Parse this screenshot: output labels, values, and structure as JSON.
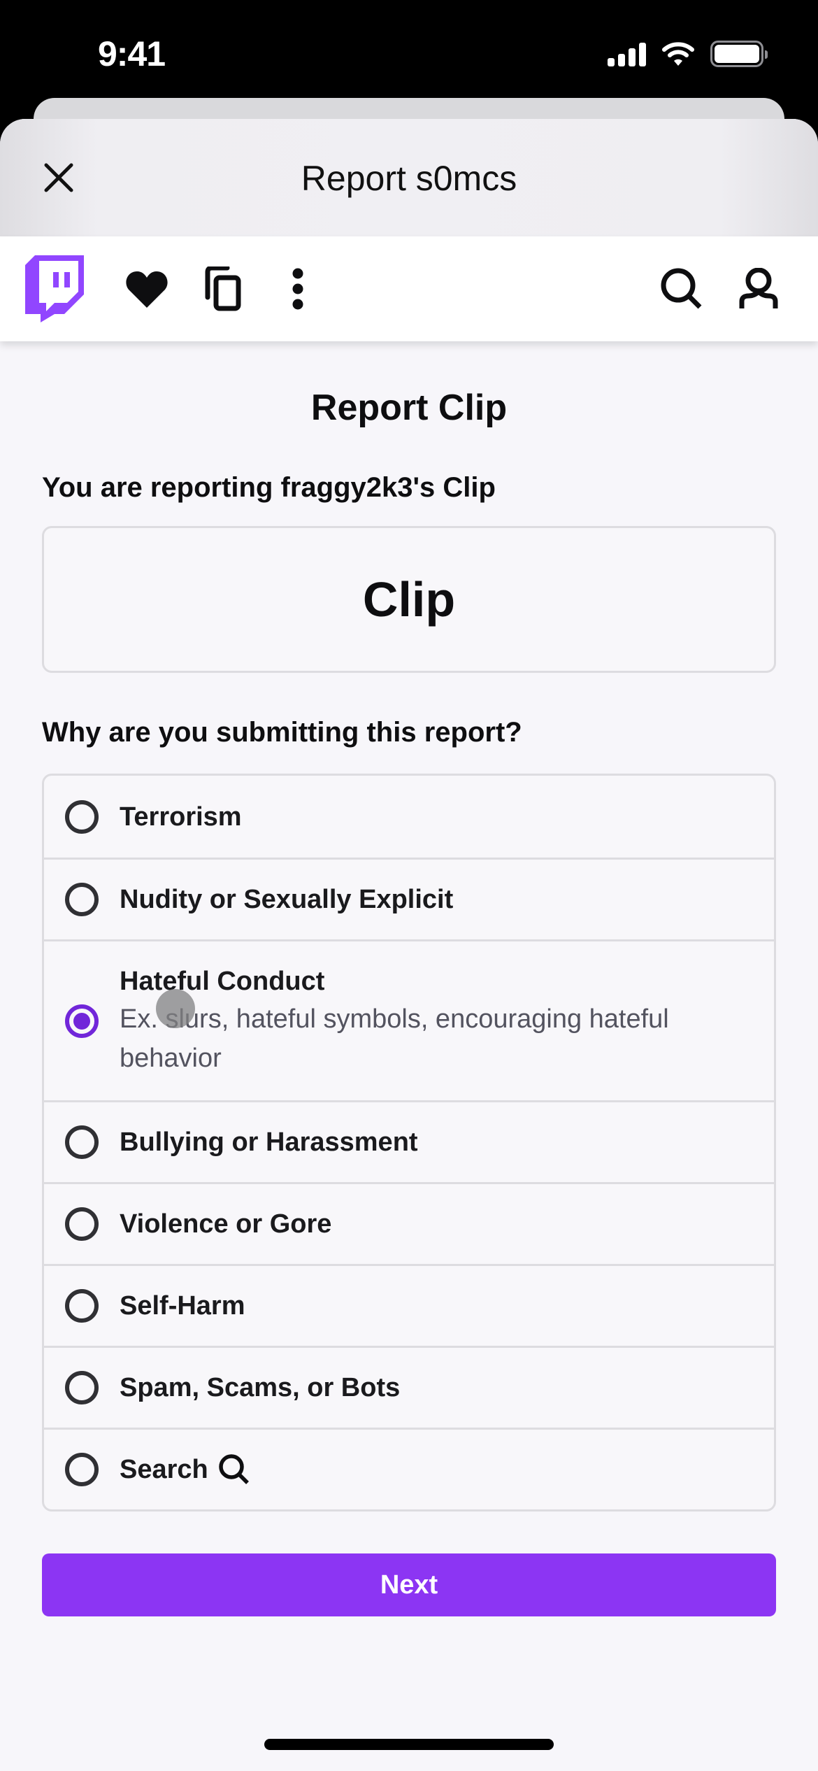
{
  "status_bar": {
    "time": "9:41",
    "signal_bars": 4,
    "wifi": "full",
    "battery_percent": 100
  },
  "sheet": {
    "title": "Report s0mcs",
    "close_icon": "close-icon"
  },
  "nav": {
    "icons": [
      "twitch-logo-icon",
      "heart-icon",
      "copy-icon",
      "more-vertical-icon",
      "search-icon",
      "user-icon"
    ],
    "brand_color": "#9146ff"
  },
  "page": {
    "title": "Report Clip",
    "reporting_label": "You are reporting fraggy2k3's Clip",
    "content_type": "Clip",
    "question": "Why are you submitting this report?",
    "options": [
      {
        "label": "Terrorism",
        "selected": false
      },
      {
        "label": "Nudity or Sexually Explicit",
        "selected": false
      },
      {
        "label": "Hateful Conduct",
        "description": "Ex. slurs, hateful symbols, encouraging hateful behavior",
        "selected": true
      },
      {
        "label": "Bullying or Harassment",
        "selected": false
      },
      {
        "label": "Violence or Gore",
        "selected": false
      },
      {
        "label": "Self-Harm",
        "selected": false
      },
      {
        "label": "Spam, Scams, or Bots",
        "selected": false
      },
      {
        "label": "Search",
        "icon": "search-icon",
        "selected": false
      }
    ],
    "next_label": "Next",
    "accent_color": "#8c35f3",
    "selected_radio_color": "#7126d9"
  }
}
